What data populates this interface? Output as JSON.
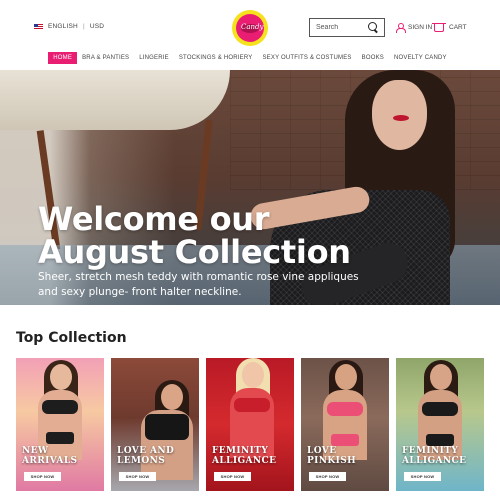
{
  "header": {
    "language": "ENGLISH",
    "currency": "USD",
    "logo_text": "Candy",
    "search_placeholder": "Search",
    "signin_label": "SIGN IN",
    "cart_label": "CART"
  },
  "nav": {
    "items": [
      "HOME",
      "BRA & PANTIES",
      "LINGERIE",
      "STOCKINGS & HORIERY",
      "SEXY OUTFITS & COSTUMES",
      "BOOKS",
      "NOVELTY CANDY"
    ],
    "active_index": 0
  },
  "hero": {
    "title_line1": "Welcome our",
    "title_line2": "August Collection",
    "subtitle": "Sheer, stretch mesh teddy with romantic rose vine appliques and sexy plunge- front halter neckline."
  },
  "collection": {
    "title": "Top Collection",
    "cards": [
      {
        "label": "NEW\nARRIVALS",
        "button": "SHOP NOW"
      },
      {
        "label": "LOVE AND\nLEMONS",
        "button": "SHOP NOW"
      },
      {
        "label": "FEMINITY\nALLIGANCE",
        "button": "SHOP NOW"
      },
      {
        "label": "LOVE\nPINKISH",
        "button": "SHOP NOW"
      },
      {
        "label": "FEMINITY\nALLIGANCE",
        "button": "SHOP NOW"
      }
    ]
  },
  "colors": {
    "accent": "#e91e73",
    "logo_yellow": "#f5e11e"
  },
  "icons": [
    "us-flag-icon",
    "search-icon",
    "user-icon",
    "cart-icon"
  ]
}
